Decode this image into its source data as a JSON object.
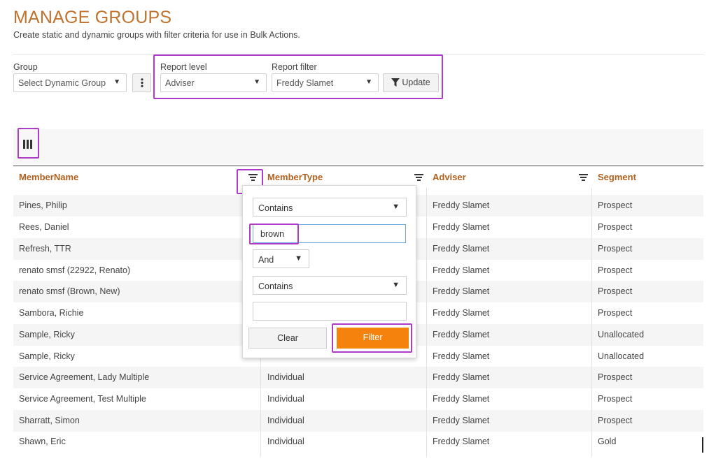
{
  "page": {
    "title": "MANAGE GROUPS",
    "subtitle": "Create static and dynamic groups with filter criteria for use in Bulk Actions."
  },
  "controls": {
    "group_label": "Group",
    "group_value": "Select Dynamic Group",
    "report_level_label": "Report level",
    "report_level_value": "Adviser",
    "report_filter_label": "Report filter",
    "report_filter_value": "Freddy Slamet",
    "update_label": "Update",
    "more_icon": "vertical-dots-icon",
    "update_icon": "funnel-icon"
  },
  "toolbar": {
    "columns_icon": "columns-icon"
  },
  "grid": {
    "columns": [
      "MemberName",
      "MemberType",
      "Adviser",
      "Segment"
    ],
    "rows": [
      [
        "Pines, Philip",
        "",
        "Freddy Slamet",
        "Prospect"
      ],
      [
        "Rees, Daniel",
        "",
        "Freddy Slamet",
        "Prospect"
      ],
      [
        "Refresh, TTR",
        "",
        "Freddy Slamet",
        "Prospect"
      ],
      [
        "renato smsf (22922, Renato)",
        "",
        "Freddy Slamet",
        "Prospect"
      ],
      [
        "renato smsf (Brown, New)",
        "",
        "Freddy Slamet",
        "Prospect"
      ],
      [
        "Sambora, Richie",
        "",
        "Freddy Slamet",
        "Prospect"
      ],
      [
        "Sample, Ricky",
        "",
        "Freddy Slamet",
        "Unallocated"
      ],
      [
        "Sample, Ricky",
        "",
        "Freddy Slamet",
        "Unallocated"
      ],
      [
        "Service Agreement, Lady Multiple",
        "Individual",
        "Freddy Slamet",
        "Prospect"
      ],
      [
        "Service Agreement, Test Multiple",
        "Individual",
        "Freddy Slamet",
        "Prospect"
      ],
      [
        "Sharratt, Simon",
        "Individual",
        "Freddy Slamet",
        "Prospect"
      ],
      [
        "Shawn, Eric",
        "Individual",
        "Freddy Slamet",
        "Gold"
      ]
    ]
  },
  "filter_popup": {
    "operator1": "Contains",
    "value1": "brown",
    "logic": "And",
    "operator2": "Contains",
    "value2": "",
    "clear_label": "Clear",
    "filter_label": "Filter"
  },
  "colors": {
    "title": "#c0722e",
    "header_text": "#b2601e",
    "filter_button": "#f5820d",
    "highlight": "#b13bc9"
  }
}
